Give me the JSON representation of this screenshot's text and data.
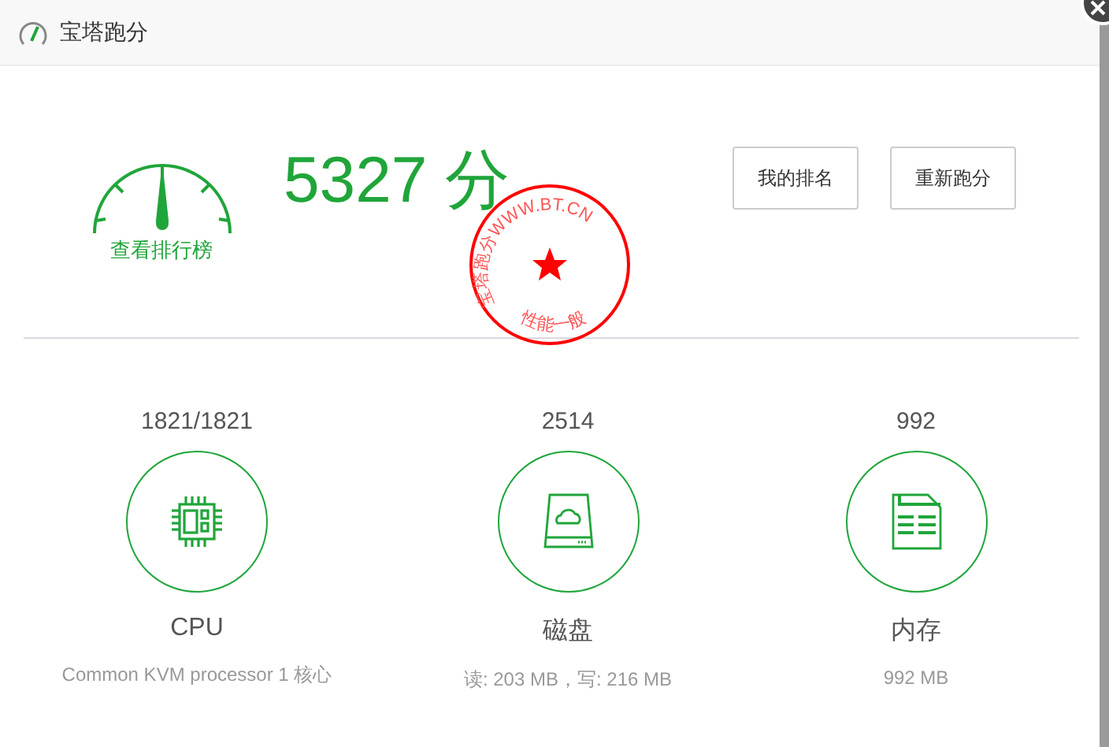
{
  "window": {
    "title": "宝塔跑分"
  },
  "score": {
    "value": "5327 分",
    "link": "查看排行榜"
  },
  "stamp": {
    "arc_text": "宝塔跑分WWW.BT.CN",
    "verdict": "性能一般"
  },
  "buttons": [
    "我的排名",
    "重新跑分"
  ],
  "metrics": [
    {
      "kind": "cpu",
      "value": "1821/1821",
      "label": "CPU",
      "detail": "Common KVM processor 1 核心"
    },
    {
      "kind": "disk",
      "value": "2514",
      "label": "磁盘",
      "detail": "读: 203 MB，写: 216 MB"
    },
    {
      "kind": "memory",
      "value": "992",
      "label": "内存",
      "detail": "992 MB"
    }
  ]
}
